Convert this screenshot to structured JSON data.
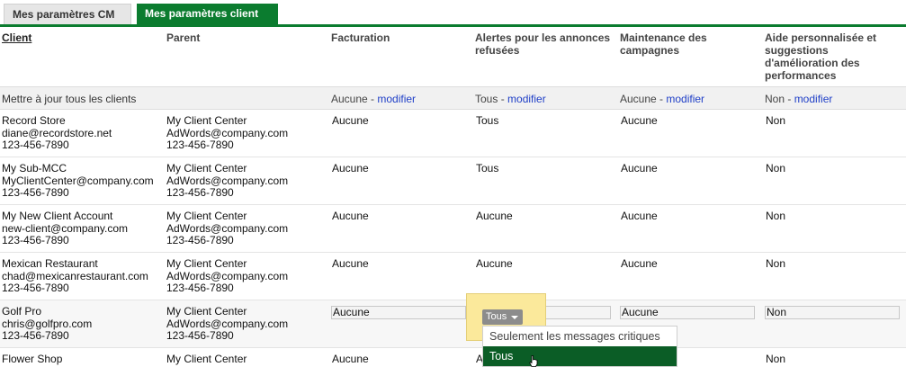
{
  "tabs": [
    {
      "label": "Mes paramètres CM",
      "active": false
    },
    {
      "label": "Mes paramètres client",
      "active": true
    }
  ],
  "headers": {
    "client": "Client",
    "parent": "Parent",
    "billing": "Facturation",
    "disapproved_1": "Alertes pour les annonces",
    "disapproved_2": "refusées",
    "maintenance_1": "Maintenance des",
    "maintenance_2": "campagnes",
    "help_1": "Aide personnalisée et",
    "help_2": "suggestions",
    "help_3": "d'amélioration des",
    "help_4": "performances"
  },
  "bulk": {
    "label": "Mettre à jour tous les clients",
    "billing": "Aucune",
    "disapproved": "Tous",
    "maintenance": "Aucune",
    "help": "Non",
    "separator": " - ",
    "modify": "modifier"
  },
  "rows": [
    {
      "name": "Record Store",
      "email": "diane@recordstore.net",
      "phone": "123-456-7890",
      "parent_name": "My Client Center",
      "parent_email": "AdWords@company.com",
      "parent_phone": "123-456-7890",
      "billing": "Aucune",
      "disapproved": "Tous",
      "maintenance": "Aucune",
      "help": "Non"
    },
    {
      "name": "My Sub-MCC",
      "email": "MyClientCenter@company.com",
      "phone": "123-456-7890",
      "parent_name": "My Client Center",
      "parent_email": "AdWords@company.com",
      "parent_phone": "123-456-7890",
      "billing": "Aucune",
      "disapproved": "Tous",
      "maintenance": "Aucune",
      "help": "Non"
    },
    {
      "name": "My New Client Account",
      "email": "new-client@company.com",
      "phone": "123-456-7890",
      "parent_name": "My Client Center",
      "parent_email": "AdWords@company.com",
      "parent_phone": "123-456-7890",
      "billing": "Aucune",
      "disapproved": "Aucune",
      "maintenance": "Aucune",
      "help": "Non"
    },
    {
      "name": "Mexican Restaurant",
      "email": "chad@mexicanrestaurant.com",
      "phone": "123-456-7890",
      "parent_name": "My Client Center",
      "parent_email": "AdWords@company.com",
      "parent_phone": "123-456-7890",
      "billing": "Aucune",
      "disapproved": "Aucune",
      "maintenance": "Aucune",
      "help": "Non"
    },
    {
      "name": "Golf Pro",
      "email": "chris@golfpro.com",
      "phone": "123-456-7890",
      "parent_name": "My Client Center",
      "parent_email": "AdWords@company.com",
      "parent_phone": "123-456-7890",
      "billing": "Aucune",
      "disapproved": "Tous",
      "maintenance": "Aucune",
      "help": "Non"
    },
    {
      "name": "Flower Shop",
      "parent_name": "My Client Center",
      "billing": "Aucune",
      "disapproved": "A",
      "help": "Non"
    }
  ],
  "dropdown": {
    "options": [
      "Seulement les messages critiques",
      "Tous"
    ]
  },
  "colors": {
    "accent": "#0b7c2f",
    "link": "#1f3fc7",
    "popup": "#fbe99b"
  }
}
